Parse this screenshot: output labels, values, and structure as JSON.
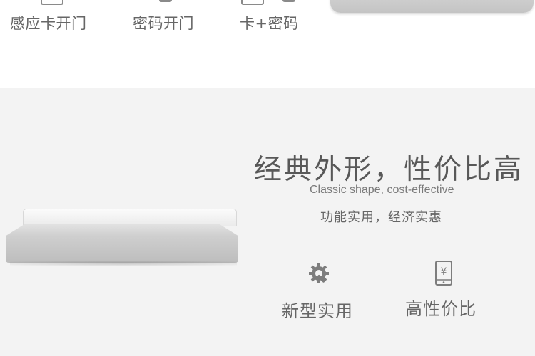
{
  "top_modes": [
    {
      "label": "感应卡开门",
      "icon": "card-icon"
    },
    {
      "label": "密码开门",
      "icon": "keypad-icon"
    },
    {
      "label": "卡+密码",
      "icon": "card-keypad-icon"
    }
  ],
  "headline": "经典外形，性价比高",
  "subtitle_en": "Classic shape, cost-effective",
  "tagline": "功能实用，经济实惠",
  "features": [
    {
      "label": "新型实用",
      "icon": "gear-wrench-icon"
    },
    {
      "label": "高性价比",
      "icon": "yen-phone-icon"
    }
  ],
  "colors": {
    "background_top": "#ffffff",
    "background_bottom": "#f3f3f3",
    "text": "#5a5a5a",
    "icon": "#7d7d7d"
  }
}
